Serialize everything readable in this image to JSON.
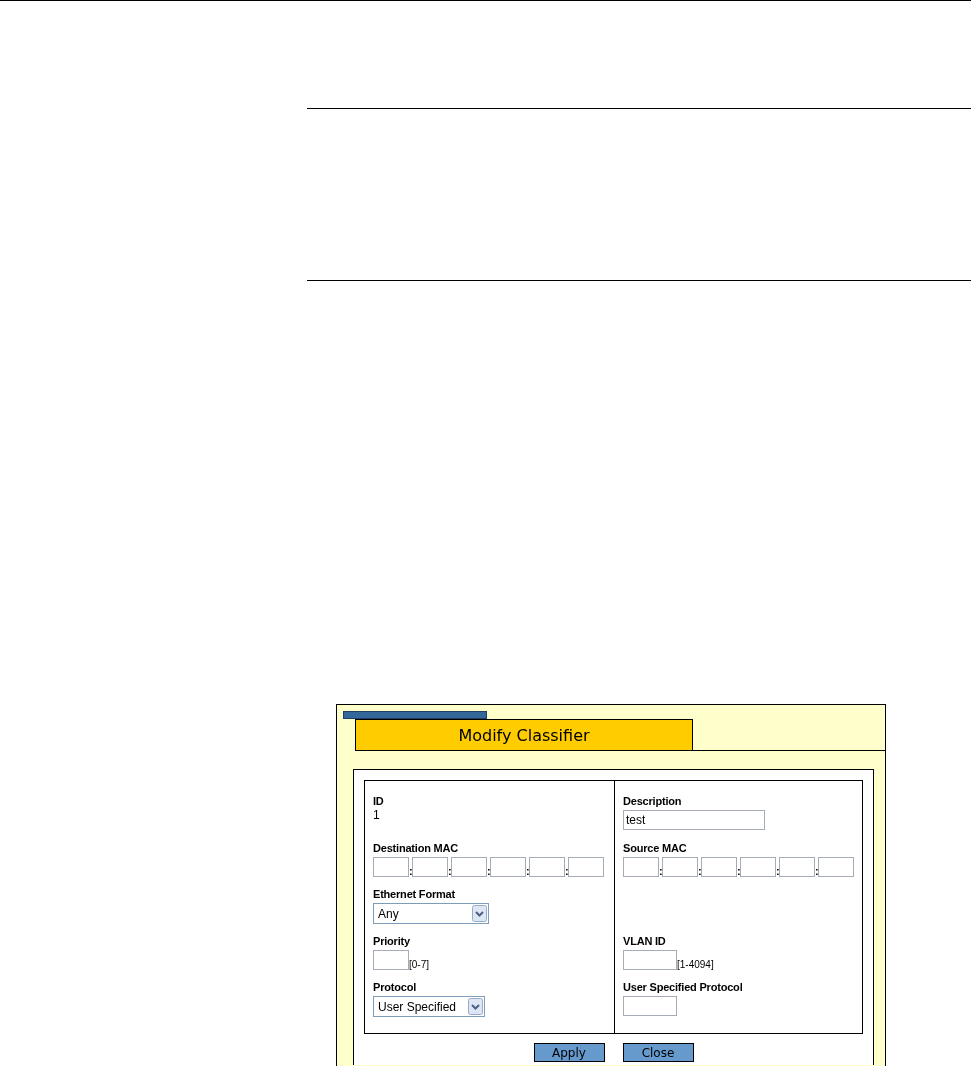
{
  "dialog": {
    "title": "Modify Classifier",
    "rows": [
      {
        "left": {
          "kind": "readonly",
          "label": "ID",
          "value": "1"
        },
        "right": {
          "kind": "input",
          "label": "Description",
          "value": "test"
        }
      },
      {
        "left": {
          "kind": "mac",
          "label": "Destination MAC",
          "separator": ":"
        },
        "right": {
          "kind": "mac",
          "label": "Source MAC",
          "separator": ":"
        }
      },
      {
        "left": {
          "kind": "select",
          "label": "Ethernet Format",
          "value": "Any"
        }
      },
      {
        "left": {
          "kind": "input",
          "label": "Priority",
          "hint": "[0-7]"
        },
        "right": {
          "kind": "input",
          "label": "VLAN ID",
          "hint": "[1-4094]"
        }
      },
      {
        "left": {
          "kind": "select",
          "label": "Protocol",
          "value": "User Specified"
        },
        "right": {
          "kind": "input",
          "label": "User Specified Protocol"
        }
      }
    ],
    "buttons": [
      "Apply",
      "Close"
    ]
  }
}
